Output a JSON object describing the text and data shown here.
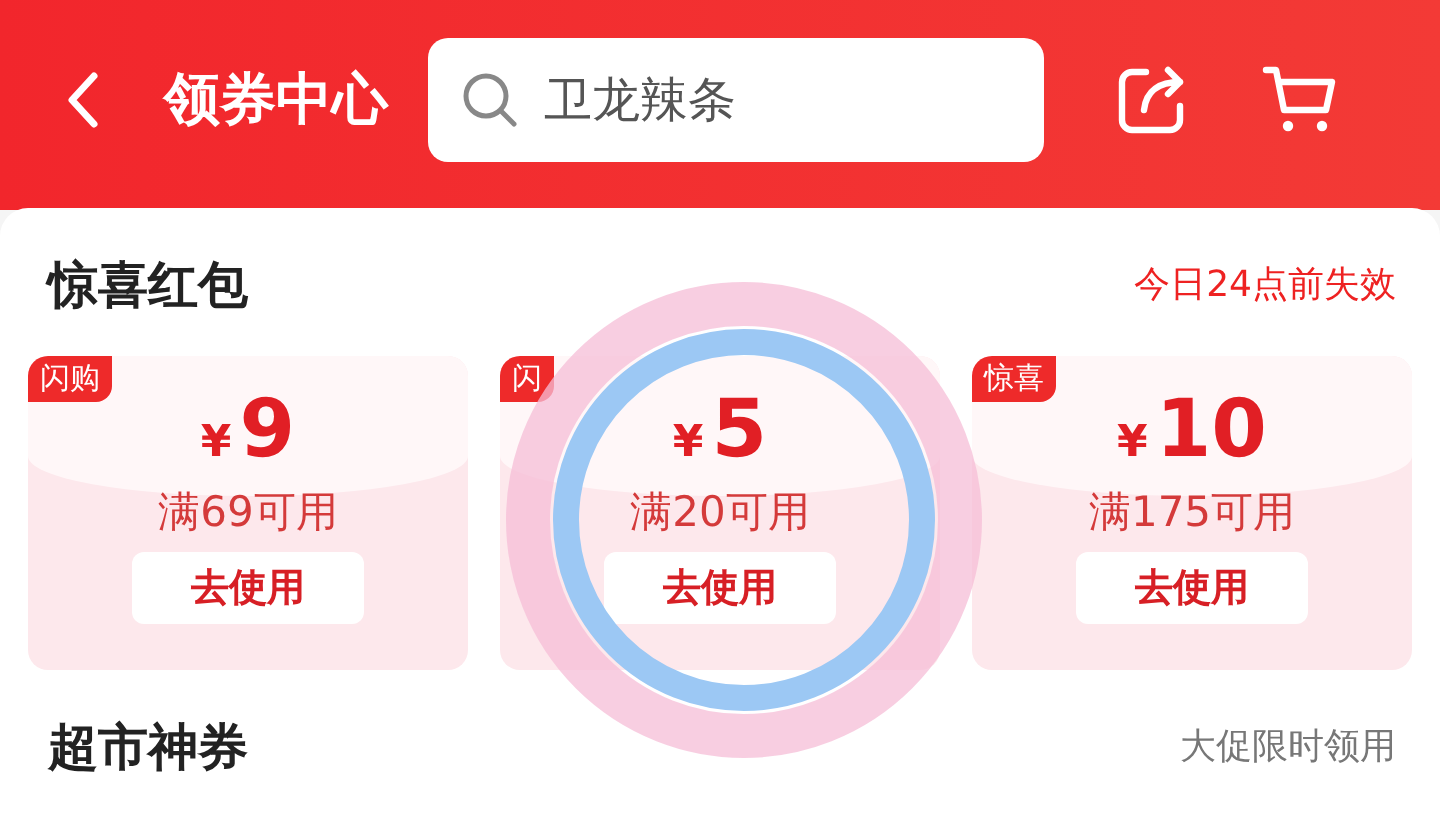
{
  "header": {
    "title": "领券中心",
    "search": {
      "placeholder": "卫龙辣条"
    }
  },
  "sections": [
    {
      "title": "惊喜红包",
      "note": "今日24点前失效",
      "kind": "alert",
      "coupons": [
        {
          "tag": "闪购",
          "currency": "¥",
          "amount": "9",
          "condition": "满69可用",
          "button": "去使用"
        },
        {
          "tag": "闪",
          "currency": "¥",
          "amount": "5",
          "condition": "满20可用",
          "button": "去使用"
        },
        {
          "tag": "惊喜",
          "currency": "¥",
          "amount": "10",
          "condition": "满175可用",
          "button": "去使用"
        }
      ]
    },
    {
      "title": "超市神券",
      "note": "大促限时领用",
      "kind": "muted"
    }
  ],
  "touch_indicator": {
    "kind": "ring"
  }
}
